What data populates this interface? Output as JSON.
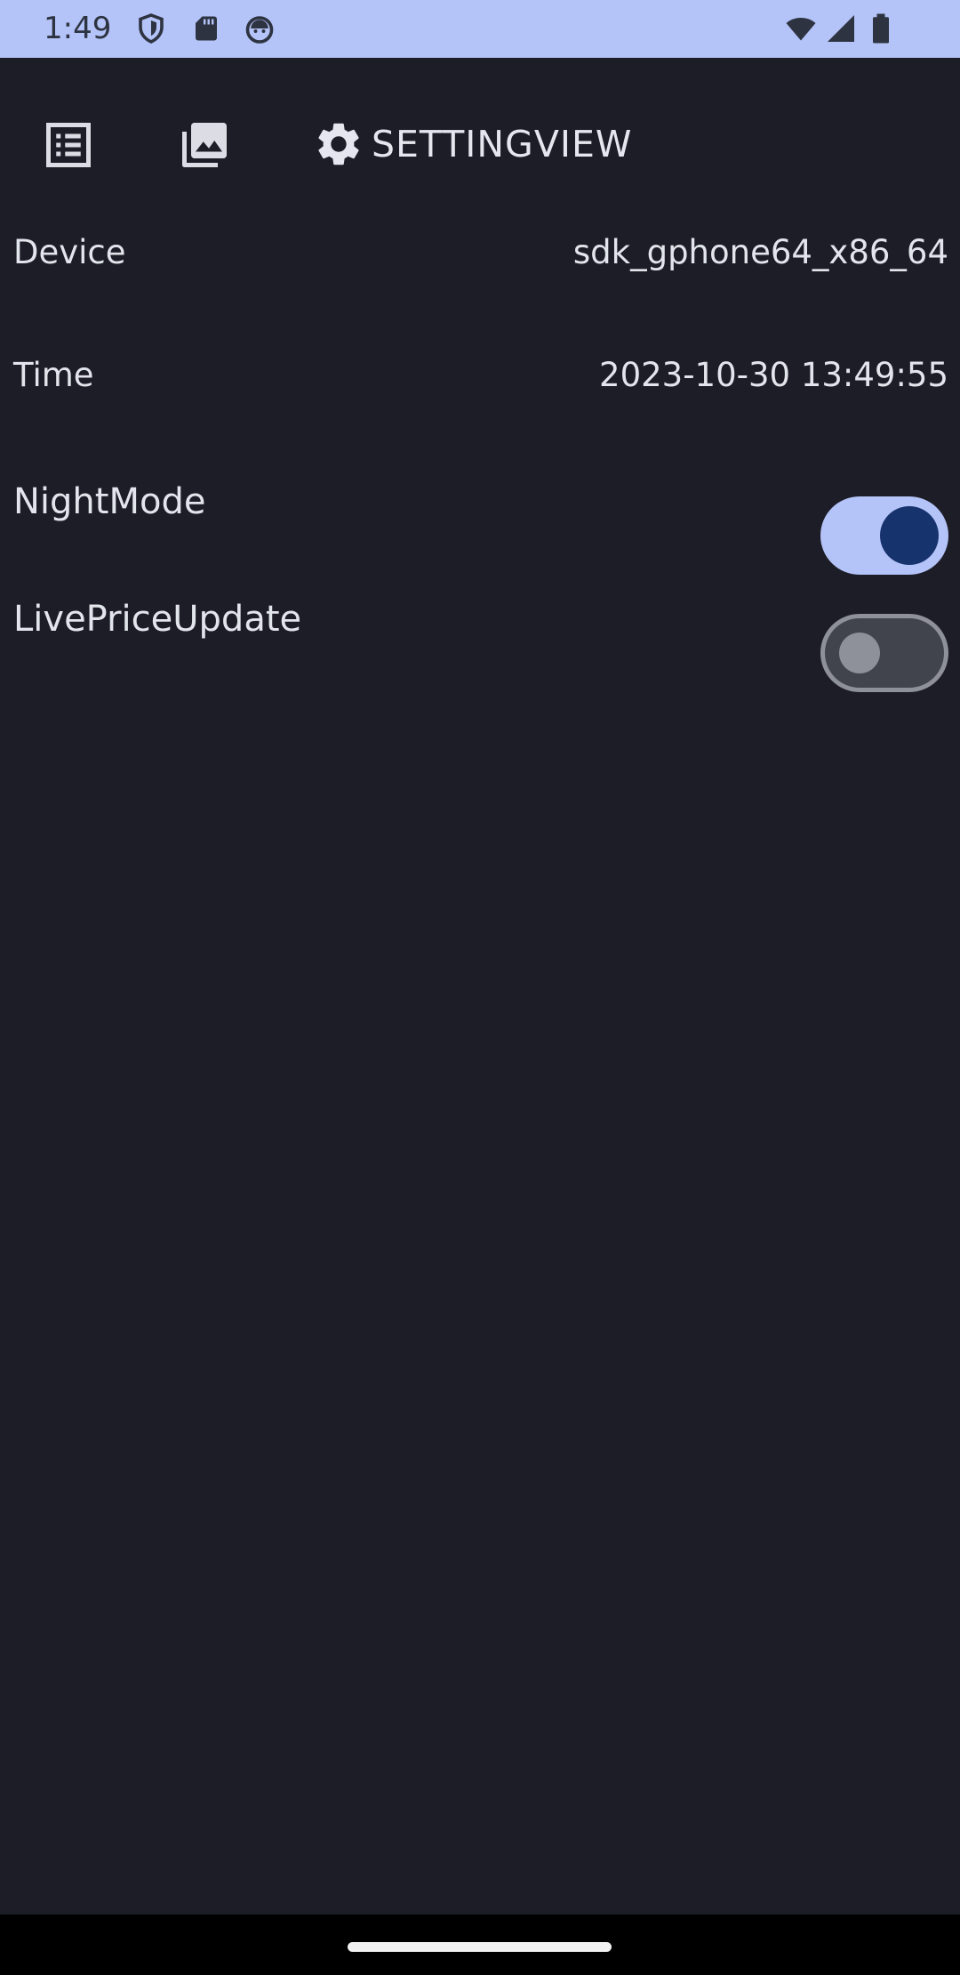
{
  "status_bar": {
    "time": "1:49",
    "background_color": "#b4c3f8",
    "icons": [
      "shield-icon",
      "sd-card-icon",
      "android-head-icon",
      "wifi-icon",
      "cellular-signal-icon",
      "battery-icon"
    ]
  },
  "tabs": {
    "items": [
      {
        "icon": "list-icon",
        "label": ""
      },
      {
        "icon": "photo-library-icon",
        "label": ""
      },
      {
        "icon": "gear-icon",
        "label": "SETTINGVIEW"
      }
    ],
    "selected_index": 2
  },
  "settings": {
    "device": {
      "label": "Device",
      "value": "sdk_gphone64_x86_64"
    },
    "time": {
      "label": "Time",
      "value": "2023-10-30 13:49:55"
    },
    "night_mode": {
      "label": "NightMode",
      "checked": true
    },
    "live_price_update": {
      "label": "LivePriceUpdate",
      "checked": false
    }
  },
  "colors": {
    "background": "#1c1d26",
    "accent": "#b4c3f8",
    "switch_thumb_on": "#17336e",
    "text": "#e3e5ec"
  }
}
